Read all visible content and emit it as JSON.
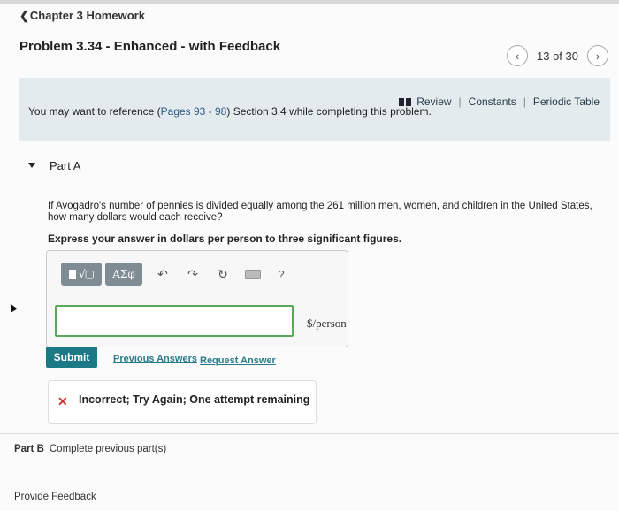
{
  "header": {
    "back_label": "Chapter 3 Homework",
    "title": "Problem 3.34 - Enhanced - with Feedback",
    "pager": {
      "text": "13 of 30",
      "prev_icon": "chevron-left",
      "next_icon": "chevron-right"
    }
  },
  "info": {
    "links": [
      "Review",
      "Constants",
      "Periodic Table"
    ],
    "ref_prefix": "You may want to reference (",
    "ref_link": "Pages 93 - 98",
    "ref_suffix": ") Section 3.4 while completing this problem."
  },
  "part_a": {
    "label": "Part A",
    "question_line1": "If Avogadro's number of pennies is divided equally among the 261 million men, women, and children in the United States,",
    "question_line2": "how many dollars would each receive?",
    "instruction": "Express your answer in dollars per person to three significant figures.",
    "toolbar": {
      "radical_label": "√▢",
      "greek_label": "ΑΣφ",
      "undo_icon": "↶",
      "redo_icon": "↷",
      "reset_icon": "↻",
      "help_label": "?"
    },
    "answer_value": "",
    "unit": "$/person",
    "submit_label": "Submit",
    "previous_answers_label": "Previous Answers",
    "request_answer_label": "Request Answer",
    "feedback": {
      "icon": "✕",
      "message": "Incorrect; Try Again; One attempt remaining"
    }
  },
  "part_b": {
    "label": "Part B",
    "text": "Complete previous part(s)"
  },
  "footer": {
    "provide_feedback": "Provide Feedback"
  },
  "colors": {
    "submit": "#1b7a86",
    "link": "#2a7a8a",
    "info_band": "#e4ebee",
    "input_border": "#5aa85a",
    "error": "#cc3333"
  }
}
